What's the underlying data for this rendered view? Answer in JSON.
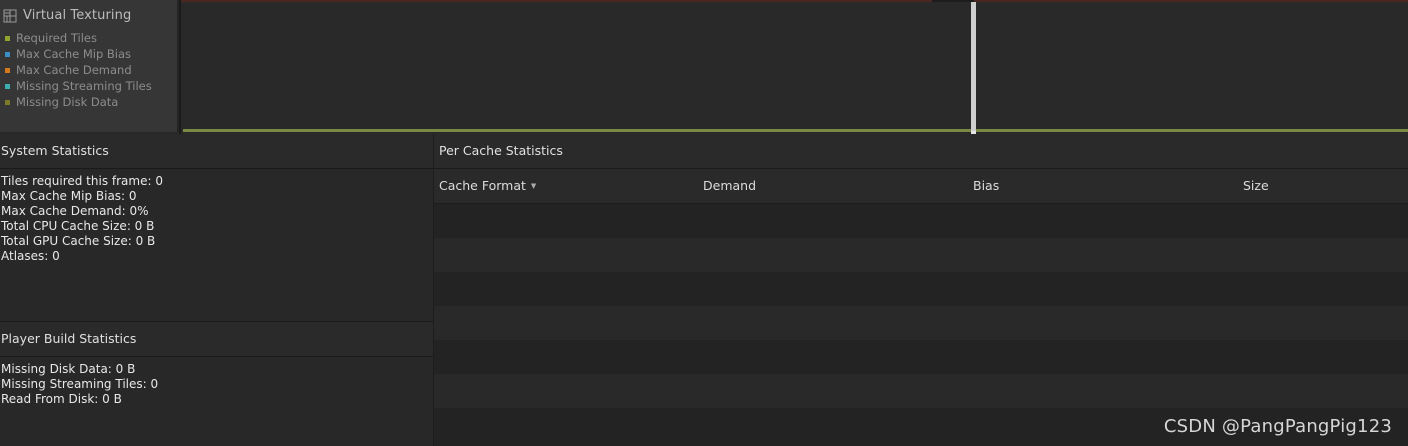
{
  "module": {
    "title": "Virtual Texturing",
    "icon": "grid-icon",
    "legend": [
      {
        "label": "Required Tiles",
        "color": "#8fa62e"
      },
      {
        "label": "Max Cache Mip Bias",
        "color": "#3b8fc4"
      },
      {
        "label": "Max Cache Demand",
        "color": "#d47a1c"
      },
      {
        "label": "Missing Streaming Tiles",
        "color": "#3aaeb0"
      },
      {
        "label": "Missing Disk Data",
        "color": "#7c7a2a"
      }
    ]
  },
  "system_statistics": {
    "title": "System Statistics",
    "lines": [
      "Tiles required this frame: 0",
      "Max Cache Mip Bias: 0",
      "Max Cache Demand: 0%",
      "Total CPU Cache Size: 0 B",
      "Total GPU Cache Size: 0 B",
      "Atlases: 0"
    ]
  },
  "player_build_statistics": {
    "title": "Player Build Statistics",
    "lines": [
      "Missing Disk Data: 0 B",
      "Missing Streaming Tiles: 0",
      "Read From Disk: 0 B"
    ]
  },
  "per_cache_statistics": {
    "title": "Per Cache Statistics",
    "columns": [
      "Cache Format",
      "Demand",
      "Bias",
      "Size"
    ],
    "sort_indicator": "▼",
    "rows": []
  },
  "watermark": "CSDN @PangPangPig123"
}
